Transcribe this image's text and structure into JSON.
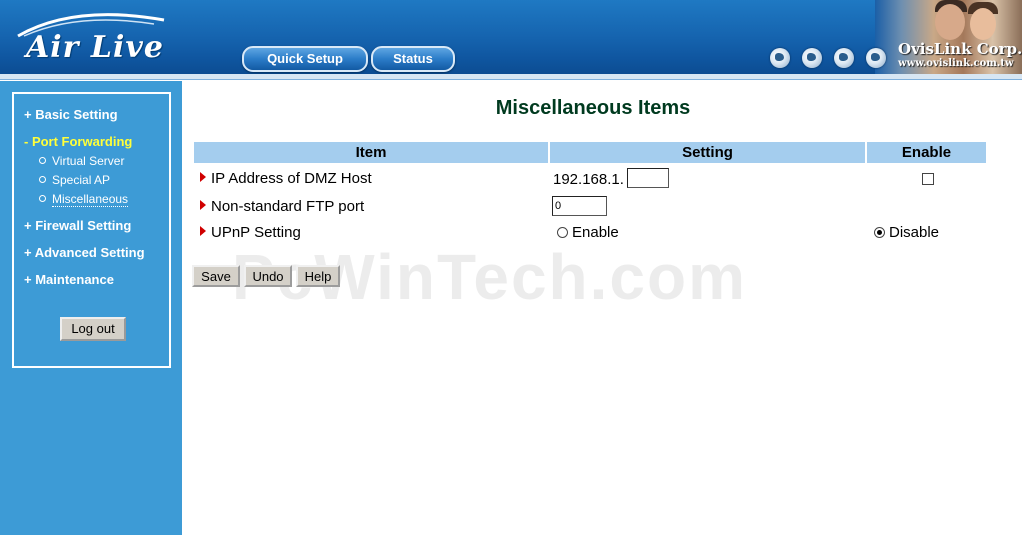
{
  "header": {
    "logo_text": "Air Live",
    "company_name": "OvisLink Corp.",
    "company_url": "www.ovislink.com.tw",
    "nav": [
      {
        "label": "Quick Setup"
      },
      {
        "label": "Status"
      }
    ]
  },
  "sidebar": {
    "items": [
      {
        "label": "+ Basic Setting"
      },
      {
        "label": "- Port Forwarding"
      },
      {
        "label": "+ Firewall Setting"
      },
      {
        "label": "+ Advanced Setting"
      },
      {
        "label": "+ Maintenance"
      }
    ],
    "subitems": [
      {
        "label": "Virtual Server"
      },
      {
        "label": "Special AP"
      },
      {
        "label": "Miscellaneous"
      }
    ],
    "logout_label": "Log out",
    "active_color": "#ffff3a"
  },
  "main": {
    "title": "Miscellaneous Items",
    "columns": [
      "Item",
      "Setting",
      "Enable"
    ],
    "rows": {
      "dmz": {
        "label": "IP Address of DMZ Host",
        "prefix": "192.168.1.",
        "value": "",
        "enabled": false
      },
      "ftp": {
        "label": "Non-standard FTP port",
        "value": "0"
      },
      "upnp": {
        "label": "UPnP Setting",
        "enable_label": "Enable",
        "disable_label": "Disable",
        "selected": "Disable"
      }
    },
    "buttons": {
      "save": "Save",
      "undo": "Undo",
      "help": "Help"
    }
  },
  "watermark": "PcWinTech.com"
}
